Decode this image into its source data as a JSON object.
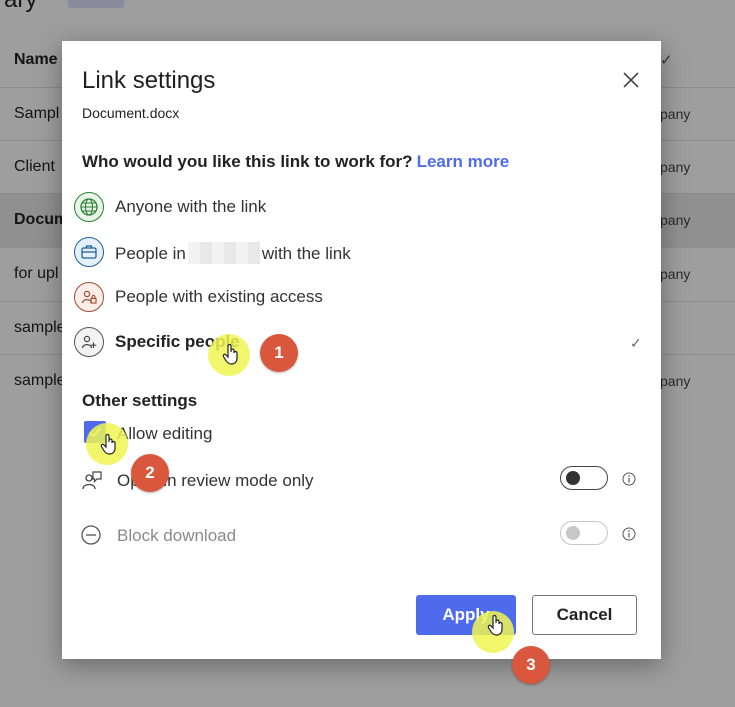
{
  "background": {
    "title": "rary",
    "columns": {
      "name": "Name",
      "modified": "✓"
    },
    "rows": [
      {
        "name": "Sampl",
        "right": "pany"
      },
      {
        "name": "Client",
        "right": "pany"
      },
      {
        "name": "Docum",
        "right": "pany"
      },
      {
        "name": "for upl",
        "right": "pany"
      },
      {
        "name": "sample",
        "right": ""
      },
      {
        "name": "sample",
        "right": "pany"
      }
    ]
  },
  "dialog": {
    "title": "Link settings",
    "file_name": "Document.docx",
    "question": "Who would you like this link to work for?",
    "learn_more": "Learn more",
    "options": {
      "anyone": "Anyone with the link",
      "people_in_prefix": "People in",
      "people_in_suffix": "with the link",
      "existing": "People with existing access",
      "specific": "Specific people",
      "specific_check": "✓"
    },
    "other_settings_title": "Other settings",
    "allow_editing": "Allow editing",
    "allow_editing_checked": true,
    "review_mode": "Open in review mode only",
    "review_mode_on": false,
    "block_download": "Block download",
    "block_download_enabled": false,
    "apply_label": "Apply",
    "cancel_label": "Cancel"
  },
  "annotations": [
    "1",
    "2",
    "3"
  ],
  "colors": {
    "accent": "#4f6bed",
    "badge": "#d9573d",
    "highlight": "#eef550"
  }
}
